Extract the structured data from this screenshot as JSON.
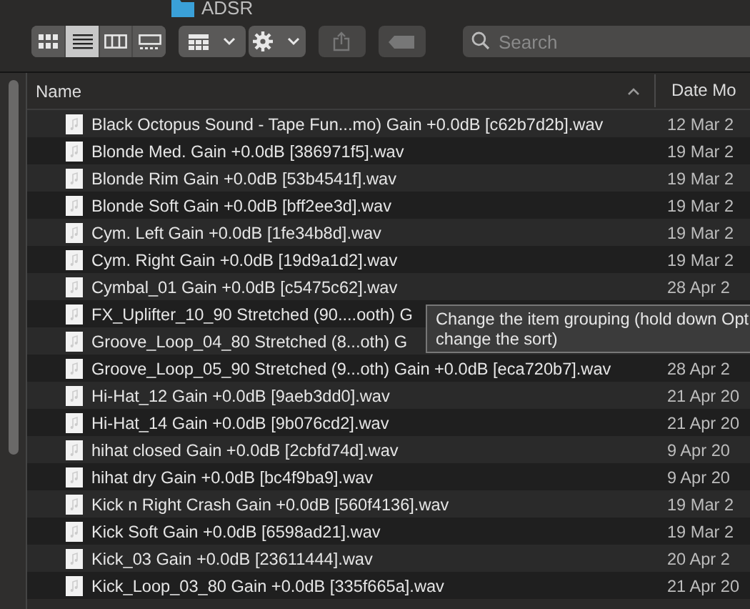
{
  "window": {
    "title": "ADSR"
  },
  "toolbar": {
    "views": [
      {
        "kind": "icons",
        "selected": false
      },
      {
        "kind": "list",
        "selected": true
      },
      {
        "kind": "columns",
        "selected": false
      },
      {
        "kind": "gallery",
        "selected": false
      }
    ],
    "share_disabled": true,
    "tags_disabled": true,
    "search": {
      "placeholder": "Search"
    }
  },
  "table": {
    "columns": [
      {
        "label": "Name"
      },
      {
        "label": "Date Mo"
      }
    ],
    "rows": [
      {
        "name": "Black Octopus Sound - Tape Fun...mo) Gain +0.0dB [c62b7d2b].wav",
        "date": "12 Mar 2"
      },
      {
        "name": "Blonde Med. Gain +0.0dB [386971f5].wav",
        "date": "19 Mar 2"
      },
      {
        "name": "Blonde Rim Gain +0.0dB [53b4541f].wav",
        "date": "19 Mar 2"
      },
      {
        "name": "Blonde Soft Gain +0.0dB [bff2ee3d].wav",
        "date": "19 Mar 2"
      },
      {
        "name": "Cym. Left Gain +0.0dB [1fe34b8d].wav",
        "date": "19 Mar 2"
      },
      {
        "name": "Cym. Right Gain +0.0dB [19d9a1d2].wav",
        "date": "19 Mar 2"
      },
      {
        "name": "Cymbal_01 Gain +0.0dB [c5475c62].wav",
        "date": "28 Apr 2"
      },
      {
        "name": "FX_Uplifter_10_90 Stretched (90....ooth) G"
      },
      {
        "name": "Groove_Loop_04_80 Stretched (8...oth) G"
      },
      {
        "name": "Groove_Loop_05_90 Stretched (9...oth) Gain +0.0dB [eca720b7].wav",
        "date": "28 Apr 2"
      },
      {
        "name": "Hi-Hat_12 Gain +0.0dB [9aeb3dd0].wav",
        "date": "21 Apr 20"
      },
      {
        "name": "Hi-Hat_14 Gain +0.0dB [9b076cd2].wav",
        "date": "21 Apr 20"
      },
      {
        "name": "hihat closed Gain +0.0dB [2cbfd74d].wav",
        "date": "9 Apr 20"
      },
      {
        "name": "hihat dry Gain +0.0dB [bc4f9ba9].wav",
        "date": "9 Apr 20"
      },
      {
        "name": "Kick n Right Crash Gain +0.0dB [560f4136].wav",
        "date": "19 Mar 2"
      },
      {
        "name": "Kick Soft Gain +0.0dB [6598ad21].wav",
        "date": "19 Mar 2"
      },
      {
        "name": "Kick_03 Gain +0.0dB [23611444].wav",
        "date": "20 Apr 2"
      },
      {
        "name": "Kick_Loop_03_80 Gain +0.0dB [335f665a].wav",
        "date": "21 Apr 20"
      }
    ]
  },
  "tooltip": {
    "lines": [
      "Change the item grouping (hold down Opt",
      "change the sort)"
    ]
  }
}
